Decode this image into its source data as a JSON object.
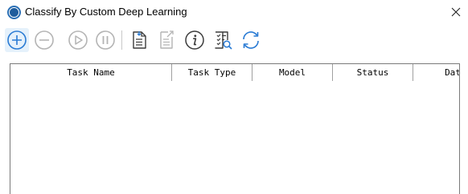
{
  "window": {
    "title": "Classify By Custom Deep Learning"
  },
  "toolbar": {
    "buttons": [
      {
        "name": "add-task-button",
        "icon": "plus-circle-icon",
        "enabled": true
      },
      {
        "name": "remove-task-button",
        "icon": "minus-circle-icon",
        "enabled": false
      },
      {
        "name": "start-button",
        "icon": "play-circle-icon",
        "enabled": false
      },
      {
        "name": "pause-button",
        "icon": "pause-circle-icon",
        "enabled": false
      },
      {
        "name": "import-button",
        "icon": "document-import-icon",
        "enabled": true
      },
      {
        "name": "export-button",
        "icon": "document-export-icon",
        "enabled": false
      },
      {
        "name": "info-button",
        "icon": "info-icon",
        "enabled": true
      },
      {
        "name": "view-report-button",
        "icon": "checklist-search-icon",
        "enabled": true
      },
      {
        "name": "refresh-button",
        "icon": "refresh-icon",
        "enabled": true
      }
    ]
  },
  "grid": {
    "columns": [
      {
        "label": "Task Name"
      },
      {
        "label": "Task Type"
      },
      {
        "label": "Model"
      },
      {
        "label": "Status"
      },
      {
        "label": "Dat"
      }
    ],
    "rows": []
  },
  "colors": {
    "accent": "#2a7bd4",
    "disabled": "#b4b4b4",
    "icon_dark": "#3c3c3c"
  }
}
